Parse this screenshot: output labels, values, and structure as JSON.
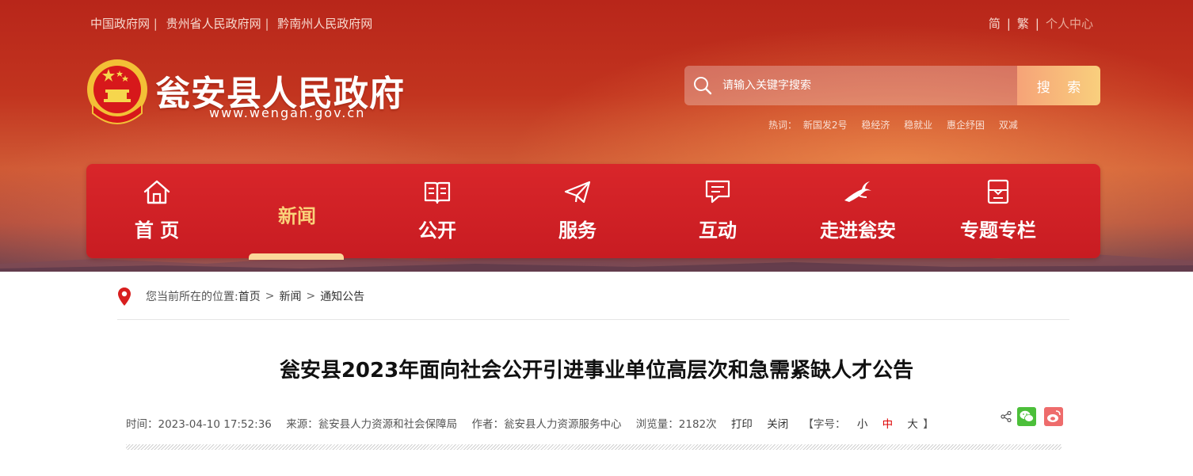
{
  "top_links": [
    "中国政府网",
    "贵州省人民政府网",
    "黔南州人民政府网"
  ],
  "top_right": {
    "simplified": "简",
    "traditional": "繁",
    "personal_center": "个人中心"
  },
  "site": {
    "title": "瓮安县人民政府",
    "domain": "www.wengan.gov.cn"
  },
  "search": {
    "placeholder": "请输入关键字搜索",
    "button": "搜 索"
  },
  "hotwords": {
    "label": "热词：",
    "items": [
      "新国发2号",
      "稳经济",
      "稳就业",
      "惠企纾困",
      "双减"
    ]
  },
  "nav": [
    {
      "label": "首 页",
      "icon": "home-icon"
    },
    {
      "label": "新闻",
      "icon": "",
      "active": true
    },
    {
      "label": "公开",
      "icon": "book-icon"
    },
    {
      "label": "服务",
      "icon": "paper-plane-icon"
    },
    {
      "label": "互动",
      "icon": "chat-icon"
    },
    {
      "label": "走进瓮安",
      "icon": "crane-icon"
    },
    {
      "label": "专题专栏",
      "icon": "folder-icon"
    }
  ],
  "breadcrumb": {
    "label": "您当前所在的位置:",
    "items": [
      "首页",
      "新闻",
      "通知公告"
    ],
    "separator": ">"
  },
  "article": {
    "title": "瓮安县2023年面向社会公开引进事业单位高层次和急需紧缺人才公告",
    "time": "时间：2023-04-10 17:52:36",
    "source": "来源：瓮安县人力资源和社会保障局",
    "author": "作者：瓮安县人力资源服务中心",
    "views": "浏览量：2182次",
    "print": "打印",
    "close": "关闭",
    "font_size_label": "【字号：",
    "font_sizes": [
      "小",
      "中",
      "大"
    ],
    "font_size_end": "】"
  },
  "colors": {
    "header_red": "#c2341f",
    "nav_red": "#d9262a",
    "active_nav": "#fad27a",
    "wechat": "#4cbf3a",
    "weibo": "#ee6c6c"
  }
}
